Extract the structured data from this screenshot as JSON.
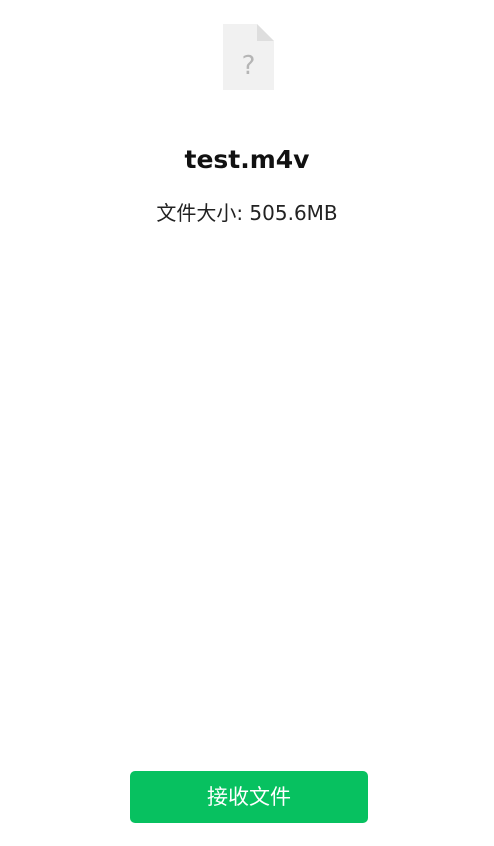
{
  "file": {
    "icon": "unknown-file-icon",
    "icon_glyph": "?",
    "name": "test.m4v",
    "size_text": "文件大小: 505.6MB"
  },
  "actions": {
    "receive_label": "接收文件"
  },
  "colors": {
    "accent": "#07C160",
    "icon_bg": "#F1F1F1",
    "icon_fold": "#DEDEDE",
    "icon_glyph": "#B5B5B5"
  }
}
